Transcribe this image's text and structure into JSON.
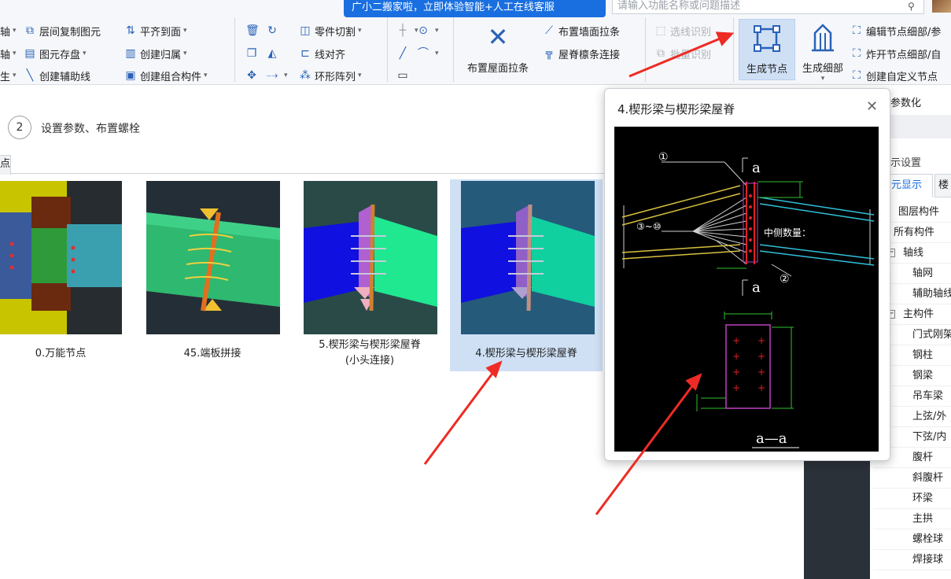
{
  "banner": {
    "text": "广小二搬家啦，立即体验智能+人工在线客服"
  },
  "search": {
    "placeholder": "请输入功能名称或问题描述"
  },
  "ribbon": {
    "col1": [
      "轴",
      "轴",
      "生"
    ],
    "group_a": [
      {
        "label": "层间复制图元",
        "icon": "copy-layer-icon"
      },
      {
        "label": "图元存盘",
        "icon": "save-element-icon",
        "dropdown": true
      },
      {
        "label": "创建辅助线",
        "icon": "aux-line-icon"
      }
    ],
    "group_b": [
      {
        "label": "平齐到面",
        "icon": "align-face-icon",
        "dropdown": true
      },
      {
        "label": "创建归属",
        "icon": "create-owner-icon",
        "dropdown": true
      },
      {
        "label": "创建组合构件",
        "icon": "combo-component-icon",
        "dropdown": true
      }
    ],
    "group_c": [
      {
        "label": "零件切割",
        "icon": "part-cut-icon",
        "dropdown": true
      },
      {
        "label": "线对齐",
        "icon": "line-align-icon"
      },
      {
        "label": "环形阵列",
        "icon": "ring-array-icon",
        "dropdown": true
      }
    ],
    "roof_brace": "布置屋面拉条",
    "wall_brace": "布置墙面拉条",
    "ridge_purlin": "屋脊檩条连接",
    "line_identify": "选线识别",
    "batch_identify": "批量识别",
    "generate_node": "生成节点",
    "generate_detail": "生成细部",
    "edit_node": "编辑节点细部/参",
    "explode_node": "炸开节点细部/自",
    "custom_node": "创建自定义节点"
  },
  "steps": {
    "step_number": "2",
    "step_label": "设置参数、布置螺栓"
  },
  "tabs": {
    "nodes_tab": "点"
  },
  "cards": [
    {
      "label": "0.万能节点"
    },
    {
      "label": "45.端板拼接"
    },
    {
      "label": "5.楔形梁与楔形梁屋脊",
      "label2": "(小头连接)"
    },
    {
      "label": "4.楔形梁与楔形梁屋脊"
    }
  ],
  "popup": {
    "title": "4.楔形梁与楔形梁屋脊",
    "cad": {
      "marker1": "①",
      "marker2": "②",
      "marker3": "③~⑩",
      "section_top": "a",
      "section_bottom": "a",
      "mid_label": "中侧数量：",
      "section_caption": "a—a"
    }
  },
  "right_panel": {
    "param_label": "参数化",
    "display_settings": "示设置",
    "tab_display": "元显示",
    "tab_floor": "楼",
    "tree": [
      "图层构件",
      "所有构件",
      "轴线",
      "轴网",
      "辅助轴线",
      "主构件",
      "门式刚架",
      "钢柱",
      "钢梁",
      "吊车梁",
      "上弦/外",
      "下弦/内",
      "腹杆",
      "斜腹杆",
      "环梁",
      "主拱",
      "螺栓球",
      "焊接球"
    ]
  },
  "colors": {
    "accent": "#1a6fe0",
    "selected_bg": "#cfe0f5",
    "arrow": "#ee2b24"
  }
}
